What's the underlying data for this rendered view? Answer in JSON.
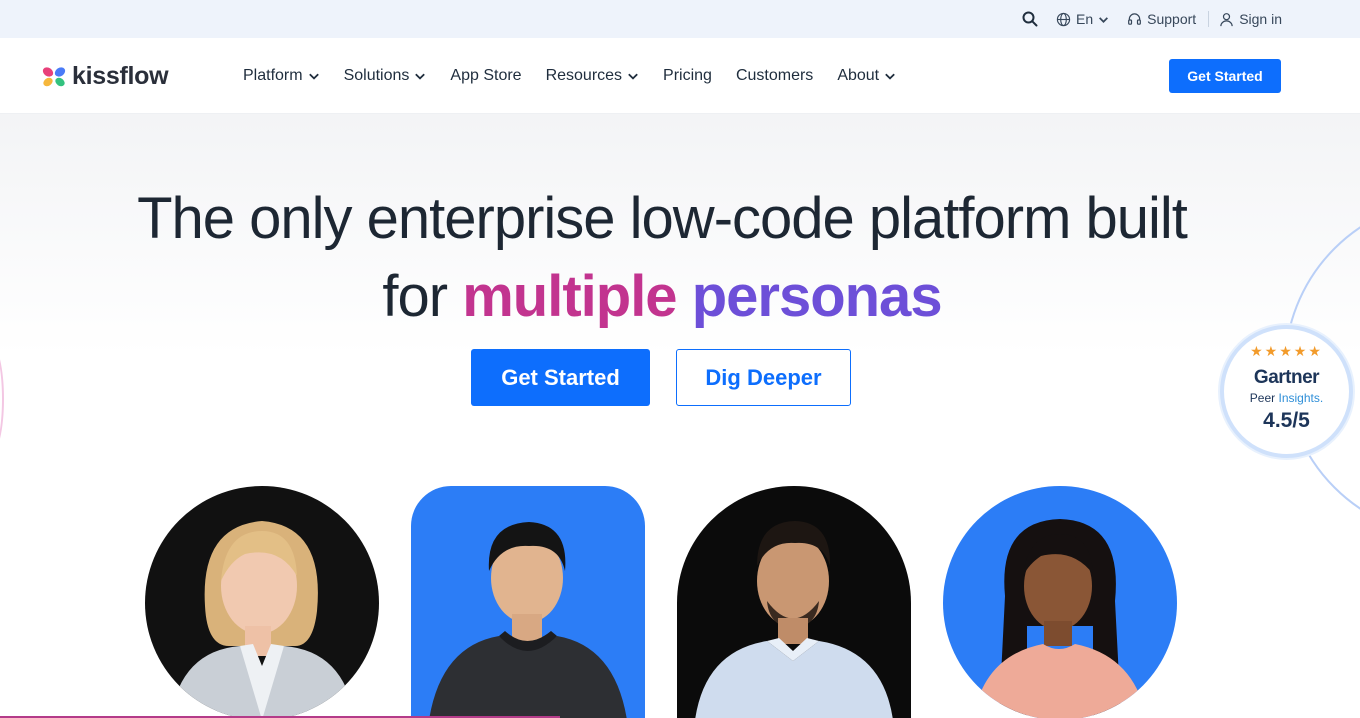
{
  "utility_bar": {
    "language": "En",
    "support": "Support",
    "sign_in": "Sign in"
  },
  "brand": {
    "name": "kissflow",
    "accent": "#0d6efd"
  },
  "nav": {
    "items": [
      {
        "label": "Platform",
        "has_dropdown": true
      },
      {
        "label": "Solutions",
        "has_dropdown": true
      },
      {
        "label": "App Store",
        "has_dropdown": false
      },
      {
        "label": "Resources",
        "has_dropdown": true
      },
      {
        "label": "Pricing",
        "has_dropdown": false
      },
      {
        "label": "Customers",
        "has_dropdown": false
      },
      {
        "label": "About",
        "has_dropdown": true
      }
    ],
    "cta": "Get Started"
  },
  "hero": {
    "title_line1": "The only enterprise low-code platform built",
    "title_line2_prefix": "for ",
    "title_highlight_1": "multiple",
    "title_highlight_2": "personas",
    "primary_cta": "Get Started",
    "secondary_cta": "Dig Deeper"
  },
  "gartner_badge": {
    "name": "Gartner",
    "sub_1": "Peer",
    "sub_2": "Insights.",
    "rating": "4.5/5",
    "stars": "★★★★★"
  },
  "personas": [
    {
      "shape": "circle",
      "bg": "#111111"
    },
    {
      "shape": "rounded-top",
      "bg": "#2c7df6"
    },
    {
      "shape": "arch",
      "bg": "#0b0b0b"
    },
    {
      "shape": "circle",
      "bg": "#2c7df6"
    }
  ]
}
